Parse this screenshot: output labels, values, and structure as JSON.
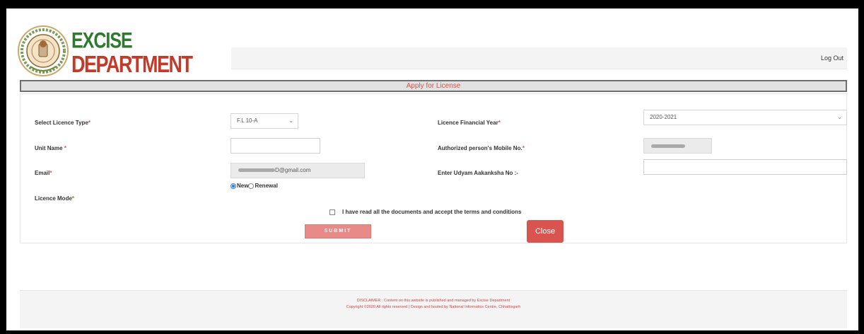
{
  "header": {
    "logo_line1": "EXCISE",
    "logo_line2": "DEPARTMENT",
    "logout_label": "Log Out"
  },
  "title_bar": "Apply for License",
  "form": {
    "licence_type_label": "Select Licence Type",
    "licence_type_value": "F.L 10-A",
    "financial_year_label": "Licence Financial Year",
    "financial_year_value": "2020-2021",
    "unit_name_label": "Unit Name",
    "unit_name_value": "",
    "mobile_label": "Authorized person's Mobile No.",
    "email_label": "Email",
    "email_value": "D@gmail.com",
    "udyam_label": "Enter Udyam Aakanksha No :-",
    "udyam_value": "",
    "licence_mode_label": "Licence Mode",
    "mode_new": "New",
    "mode_renewal": "Renewal",
    "mode_selected": "New",
    "terms_text": "I have read all the documents and accept the terms and conditions",
    "submit_label": "SUBMIT",
    "close_label": "Close",
    "required_mark": "*"
  },
  "footer": {
    "disclaimer": "DISCLAIMER : Content on this website is published and managed by Excise Department",
    "copyright": "Copyright ©2020 All rights reserved | Design and hosted by National Informatics Centre, Chhattisgarh"
  },
  "colors": {
    "accent_red": "#d9534f",
    "logo_green": "#2f7a2f",
    "logo_red": "#c23a2a",
    "icons": [
      "emblem-icon",
      "chevron-down-icon"
    ]
  }
}
